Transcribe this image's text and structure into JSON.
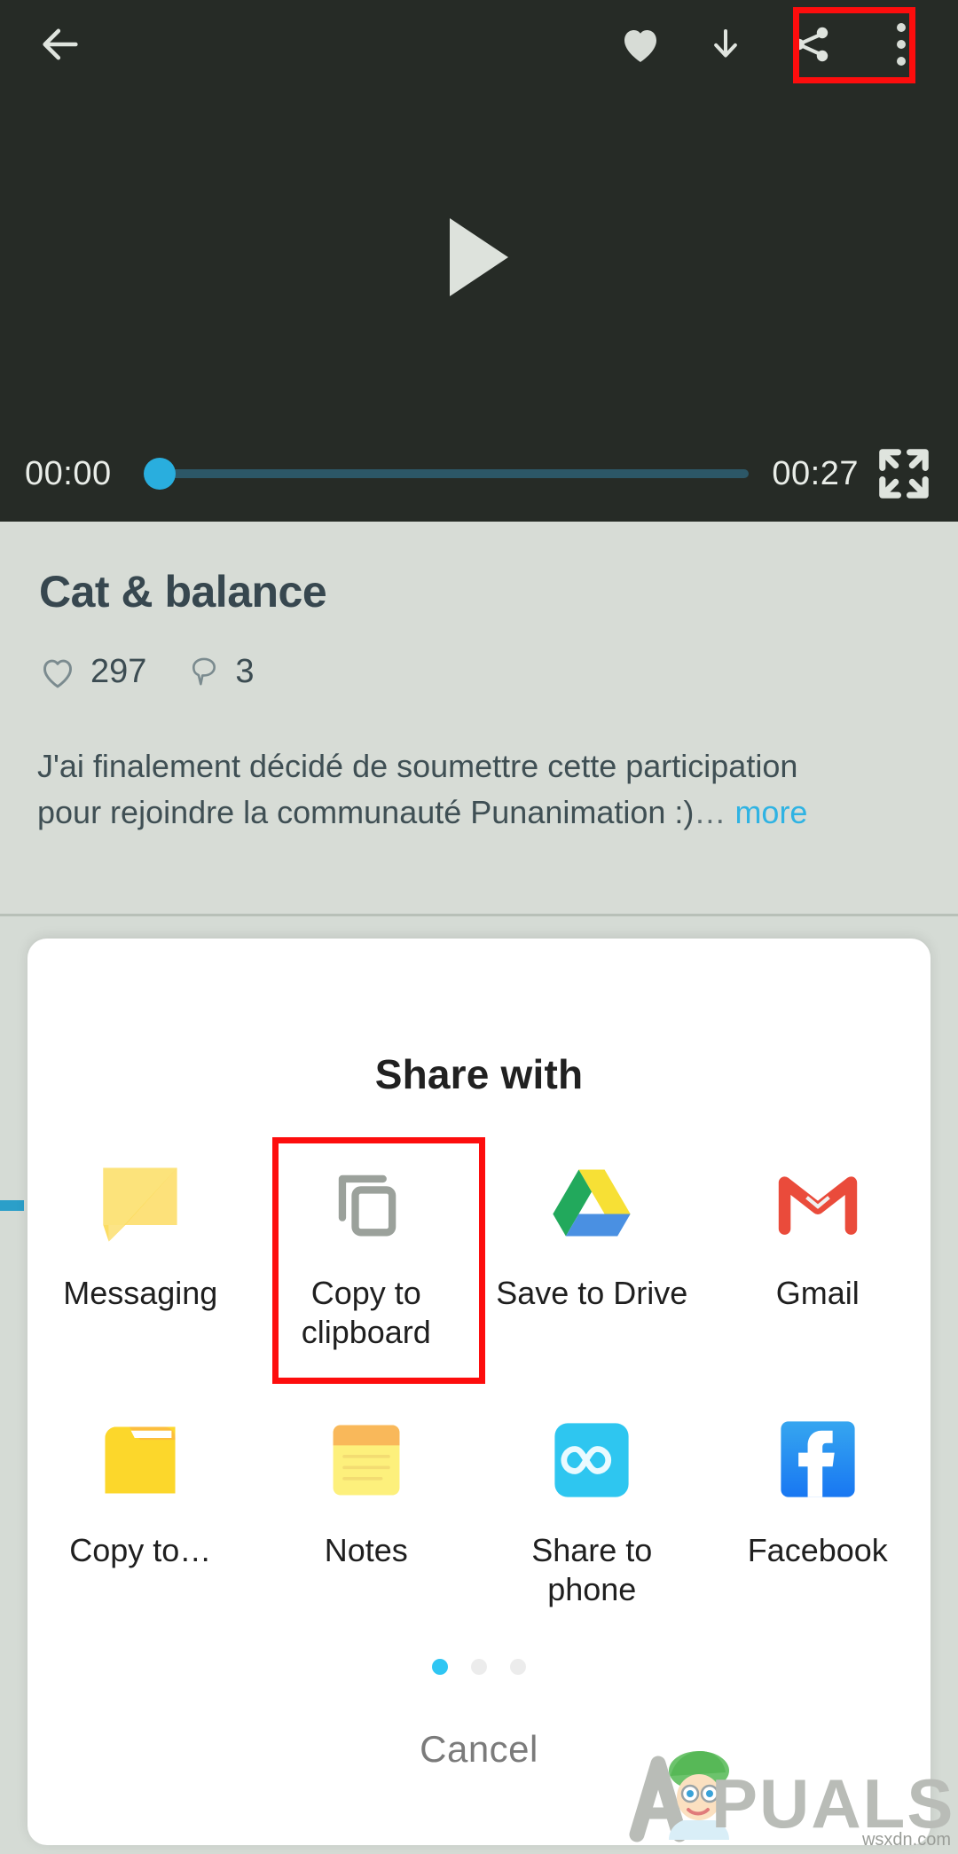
{
  "player": {
    "appbar": {
      "back_icon": "back-arrow-icon",
      "favorite_icon": "heart-icon",
      "download_icon": "download-arrow-icon",
      "share_icon": "share-icon",
      "overflow_icon": "kebab-menu-icon"
    },
    "play_icon": "play-triangle-icon",
    "current_time": "00:00",
    "total_time": "00:27",
    "fullscreen_icon": "fullscreen-icon",
    "progress_percent": 1,
    "accent_color": "#29aede",
    "background_color": "#262b26"
  },
  "detail": {
    "title": "Cat & balance",
    "likes": "297",
    "likes_icon": "heart-outline-icon",
    "comments": "3",
    "comments_icon": "comment-bubble-icon",
    "description": "J'ai finalement décidé de soumettre cette participation pour rejoindre la communauté Punanimation :)",
    "description_ellipsis": "…",
    "more_label": "more",
    "more_color": "#2fb3e3",
    "background_color": "#d7dcd6"
  },
  "share_sheet": {
    "title": "Share with",
    "cancel_label": "Cancel",
    "page_dots": {
      "count": 3,
      "active_index": 0,
      "active_color": "#2fc6f3"
    },
    "targets": [
      {
        "label": "Messaging",
        "icon": "messaging-bubble-icon",
        "highlighted": false
      },
      {
        "label": "Copy to clipboard",
        "icon": "copy-to-clipboard-icon",
        "highlighted": true
      },
      {
        "label": "Save to Drive",
        "icon": "google-drive-icon",
        "highlighted": false
      },
      {
        "label": "Gmail",
        "icon": "gmail-m-icon",
        "highlighted": false
      },
      {
        "label": "Copy to…",
        "icon": "yellow-folder-icon",
        "highlighted": false
      },
      {
        "label": "Notes",
        "icon": "notes-pad-icon",
        "highlighted": false
      },
      {
        "label": "Share to phone",
        "icon": "share-to-phone-infinity-icon",
        "highlighted": false
      },
      {
        "label": "Facebook",
        "icon": "facebook-f-icon",
        "highlighted": false
      }
    ]
  },
  "annotations": {
    "highlight_color": "#fd0d0d",
    "boxes": [
      {
        "name": "share-button-highlight",
        "target": "share-icon"
      },
      {
        "name": "copy-to-clipboard-highlight",
        "target": "copy-to-clipboard"
      }
    ]
  },
  "watermark": {
    "brand": "PUALS",
    "source": "wsxdn.com"
  }
}
